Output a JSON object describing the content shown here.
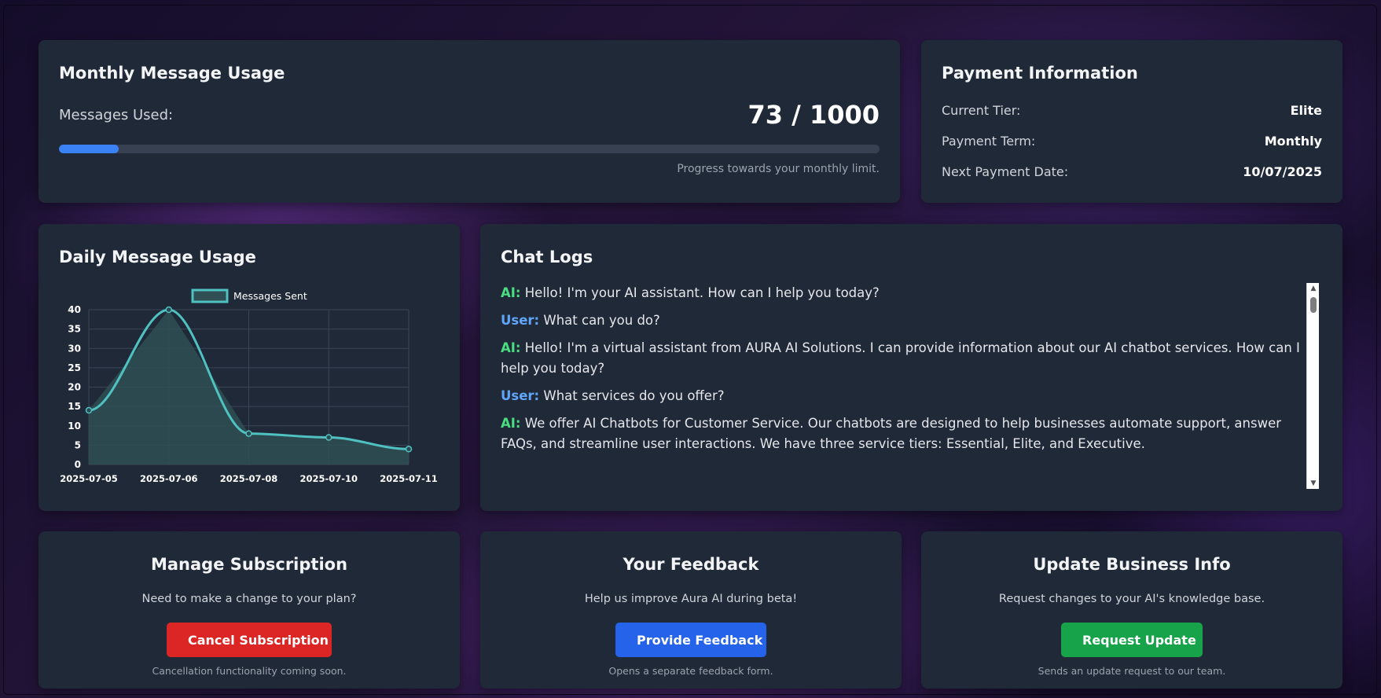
{
  "usage": {
    "title": "Monthly Message Usage",
    "label": "Messages Used:",
    "count": "73 / 1000",
    "used": 73,
    "limit": 1000,
    "note": "Progress towards your monthly limit."
  },
  "payment": {
    "title": "Payment Information",
    "rows": [
      {
        "key": "Current Tier:",
        "value": "Elite"
      },
      {
        "key": "Payment Term:",
        "value": "Monthly"
      },
      {
        "key": "Next Payment Date:",
        "value": "10/07/2025"
      }
    ]
  },
  "daily": {
    "title": "Daily Message Usage"
  },
  "chart_data": {
    "type": "line",
    "x": [
      "2025-07-05",
      "2025-07-06",
      "2025-07-08",
      "2025-07-10",
      "2025-07-11"
    ],
    "series": [
      {
        "name": "Messages Sent",
        "values": [
          14,
          40,
          8,
          7,
          4
        ]
      }
    ],
    "ylim": [
      0,
      40
    ],
    "yticks": [
      0,
      5,
      10,
      15,
      20,
      25,
      30,
      35,
      40
    ],
    "grid": true,
    "fill": true,
    "legend": "top",
    "colors": {
      "line": "#4fc1c0",
      "fill": "#2f4f55"
    }
  },
  "chat": {
    "title": "Chat Logs",
    "messages": [
      {
        "who": "AI:",
        "role": "ai",
        "text": "Hello! I'm your AI assistant. How can I help you today?"
      },
      {
        "who": "User:",
        "role": "user",
        "text": "What can you do?"
      },
      {
        "who": "AI:",
        "role": "ai",
        "text": "Hello! I'm a virtual assistant from AURA AI Solutions. I can provide information about our AI chatbot services. How can I help you today?"
      },
      {
        "who": "User:",
        "role": "user",
        "text": "What services do you offer?"
      },
      {
        "who": "AI:",
        "role": "ai",
        "text": "We offer AI Chatbots for Customer Service. Our chatbots are designed to help businesses automate support, answer FAQs, and streamline user interactions. We have three service tiers: Essential, Elite, and Executive."
      }
    ]
  },
  "manage": {
    "title": "Manage Subscription",
    "desc": "Need to make a change to your plan?",
    "button": "Cancel Subscription",
    "note": "Cancellation functionality coming soon."
  },
  "feedback": {
    "title": "Your Feedback",
    "desc": "Help us improve Aura AI during beta!",
    "button": "Provide Feedback",
    "note": "Opens a separate feedback form."
  },
  "business": {
    "title": "Update Business Info",
    "desc": "Request changes to your AI's knowledge base.",
    "button": "Request Update",
    "note": "Sends an update request to our team."
  },
  "colors": {
    "accent": "#3b82f6",
    "danger": "#dc2626",
    "primary": "#2563eb",
    "success": "#16a34a",
    "card": "#1f2937"
  }
}
